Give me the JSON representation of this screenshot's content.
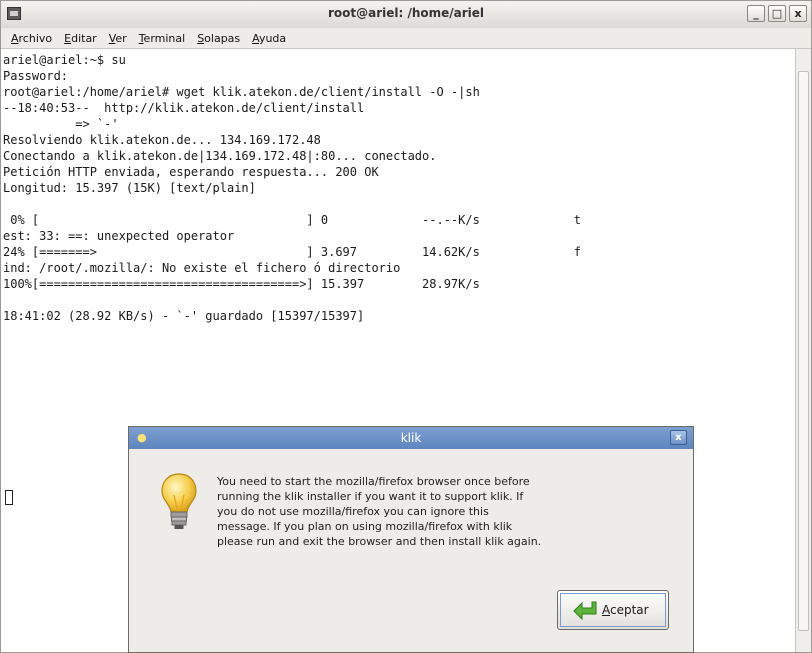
{
  "window": {
    "title": "root@ariel: /home/ariel",
    "minimize_glyph": "_",
    "maximize_glyph": "□",
    "close_glyph": "x"
  },
  "menu": [
    "Archivo",
    "Editar",
    "Ver",
    "Terminal",
    "Solapas",
    "Ayuda"
  ],
  "terminal": {
    "lines": [
      "ariel@ariel:~$ su",
      "Password:",
      "root@ariel:/home/ariel# wget klik.atekon.de/client/install -O -|sh",
      "--18:40:53--  http://klik.atekon.de/client/install",
      "          => `-'",
      "Resolviendo klik.atekon.de... 134.169.172.48",
      "Conectando a klik.atekon.de|134.169.172.48|:80... conectado.",
      "Petición HTTP enviada, esperando respuesta... 200 OK",
      "Longitud: 15.397 (15K) [text/plain]",
      "",
      " 0% [                                     ] 0             --.--K/s             t",
      "est: 33: ==: unexpected operator",
      "24% [=======>                             ] 3.697         14.62K/s             f",
      "ind: /root/.mozilla/: No existe el fichero ó directorio",
      "100%[====================================>] 15.397        28.97K/s",
      "",
      "18:41:02 (28.92 KB/s) - `-' guardado [15397/15397]"
    ]
  },
  "dialog": {
    "title": "klik",
    "close_glyph": "x",
    "message": "You need to start the mozilla/firefox browser once before\nrunning the klik installer if you want it to support klik.  If\nyou do not use mozilla/firefox you can ignore this\nmessage.  If you plan on using mozilla/firefox with klik\nplease run and exit the browser and then install klik again.",
    "button_label": "Aceptar",
    "icon": "lightbulb-icon",
    "accent_color": "#6f93c9"
  }
}
